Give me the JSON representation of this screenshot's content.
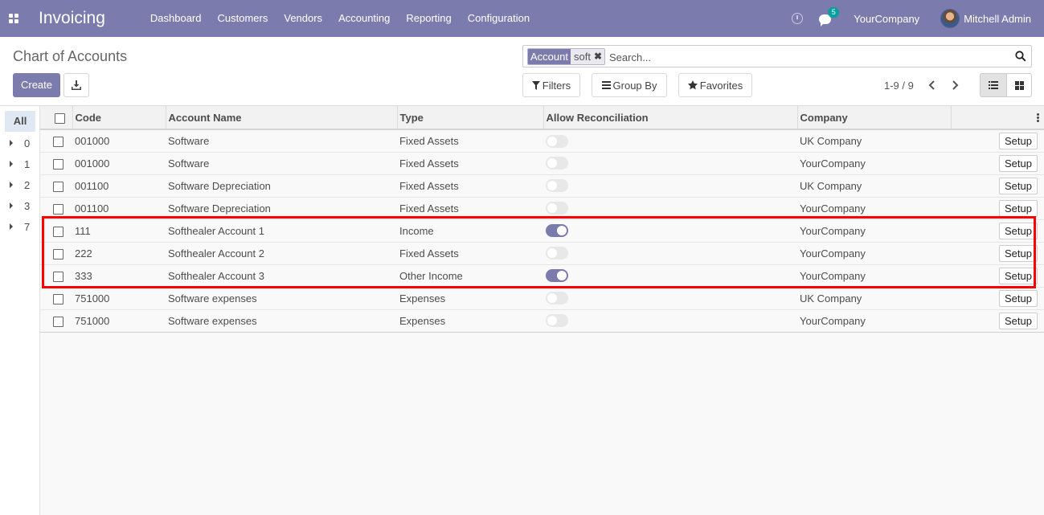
{
  "navbar": {
    "app_title": "Invoicing",
    "menu": [
      "Dashboard",
      "Customers",
      "Vendors",
      "Accounting",
      "Reporting",
      "Configuration"
    ],
    "messages_count": "5",
    "company": "YourCompany",
    "user": "Mitchell Admin",
    "accent_color": "#7c7bad"
  },
  "control_panel": {
    "title": "Chart of Accounts",
    "create_label": "Create",
    "search": {
      "facet_label": "Account",
      "facet_value": "soft",
      "placeholder": "Search..."
    },
    "filters_label": "Filters",
    "groupby_label": "Group By",
    "favorites_label": "Favorites",
    "pager": "1-9 / 9"
  },
  "side_panel": {
    "all_label": "All",
    "groups": [
      "0",
      "1",
      "2",
      "3",
      "7"
    ]
  },
  "table": {
    "columns": [
      "Code",
      "Account Name",
      "Type",
      "Allow Reconciliation",
      "Company"
    ],
    "setup_label": "Setup",
    "rows": [
      {
        "code": "001000",
        "name": "Software",
        "type": "Fixed Assets",
        "reconcile": false,
        "company": "UK Company"
      },
      {
        "code": "001000",
        "name": "Software",
        "type": "Fixed Assets",
        "reconcile": false,
        "company": "YourCompany"
      },
      {
        "code": "001100",
        "name": "Software Depreciation",
        "type": "Fixed Assets",
        "reconcile": false,
        "company": "UK Company"
      },
      {
        "code": "001100",
        "name": "Software Depreciation",
        "type": "Fixed Assets",
        "reconcile": false,
        "company": "YourCompany"
      },
      {
        "code": "111",
        "name": "Softhealer Account 1",
        "type": "Income",
        "reconcile": true,
        "company": "YourCompany"
      },
      {
        "code": "222",
        "name": "Softhealer Account 2",
        "type": "Fixed Assets",
        "reconcile": false,
        "company": "YourCompany"
      },
      {
        "code": "333",
        "name": "Softhealer Account 3",
        "type": "Other Income",
        "reconcile": true,
        "company": "YourCompany"
      },
      {
        "code": "751000",
        "name": "Software expenses",
        "type": "Expenses",
        "reconcile": false,
        "company": "UK Company"
      },
      {
        "code": "751000",
        "name": "Software expenses",
        "type": "Expenses",
        "reconcile": false,
        "company": "YourCompany"
      }
    ]
  },
  "annotation": {
    "highlight_color": "#ff0000"
  }
}
